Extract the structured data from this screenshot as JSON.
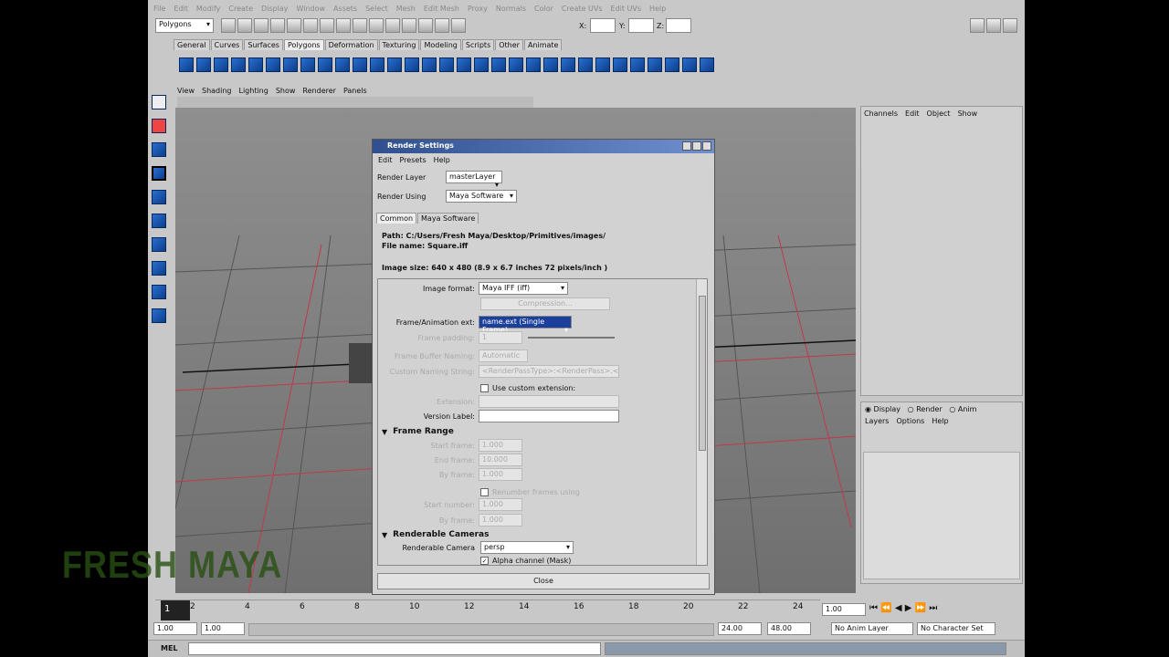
{
  "menubar": [
    "File",
    "Edit",
    "Modify",
    "Create",
    "Display",
    "Window",
    "Assets",
    "Select",
    "Mesh",
    "Edit Mesh",
    "Proxy",
    "Normals",
    "Color",
    "Create UVs",
    "Edit UVs",
    "Help"
  ],
  "mode_select": "Polygons",
  "coord_labels": {
    "x": "X:",
    "y": "Y:",
    "z": "Z:"
  },
  "shelf_tabs": [
    "General",
    "Curves",
    "Surfaces",
    "Polygons",
    "Deformation",
    "Texturing",
    "Modeling",
    "Scripts",
    "Other",
    "Animate"
  ],
  "shelf_selected": "Polygons",
  "viewport_menu": [
    "View",
    "Shading",
    "Lighting",
    "Show",
    "Renderer",
    "Panels"
  ],
  "render_settings": {
    "title": "Render Settings",
    "menu": [
      "Edit",
      "Presets",
      "Help"
    ],
    "render_layer_label": "Render Layer",
    "render_layer_value": "masterLayer",
    "render_using_label": "Render Using",
    "render_using_value": "Maya Software",
    "tabs": [
      "Common",
      "Maya Software"
    ],
    "path": "Path: C:/Users/Fresh Maya/Desktop/Primitives/images/",
    "filename": "File name:  Square.iff",
    "image_size": "Image size: 640 x 480 (8.9 x 6.7 inches 72 pixels/inch )",
    "image_format_label": "Image format:",
    "image_format_value": "Maya IFF (iff)",
    "compression_label": "Compression...",
    "frame_anim_label": "Frame/Animation ext:",
    "frame_anim_value": "name.ext (Single Frame)",
    "frame_padding_label": "Frame padding:",
    "frame_padding_value": "1",
    "fb_naming_label": "Frame Buffer Naming:",
    "fb_naming_value": "Automatic",
    "custom_naming_label": "Custom Naming String:",
    "custom_naming_value": "<RenderPassType>:<RenderPass>.<Came",
    "use_custom_ext": "Use custom extension:",
    "extension_label": "Extension:",
    "version_label": "Version Label:",
    "frame_range_header": "Frame Range",
    "start_frame_label": "Start frame:",
    "start_frame_value": "1.000",
    "end_frame_label": "End frame:",
    "end_frame_value": "10.000",
    "by_frame_label": "By frame:",
    "by_frame_value": "1.000",
    "renumber_label": "Renumber frames using",
    "start_number_label": "Start number:",
    "start_number_value": "1.000",
    "by_frame2_label": "By frame:",
    "by_frame2_value": "1.000",
    "cameras_header": "Renderable Cameras",
    "renderable_camera_label": "Renderable Camera",
    "renderable_camera_value": "persp",
    "alpha_label": "Alpha channel (Mask)",
    "close": "Close"
  },
  "channel_box": {
    "menu": [
      "Channels",
      "Edit",
      "Object",
      "Show"
    ]
  },
  "layers": {
    "radios": [
      "Display",
      "Render",
      "Anim"
    ],
    "menu": [
      "Layers",
      "Options",
      "Help"
    ]
  },
  "timeline": {
    "ticks": [
      "2",
      "4",
      "6",
      "8",
      "10",
      "12",
      "14",
      "16",
      "18",
      "20",
      "22",
      "24"
    ],
    "current": "1",
    "current_field": "1.00"
  },
  "range": {
    "start": "1.00",
    "start2": "1.00",
    "end": "24.00",
    "end2": "48.00",
    "anim_layer": "No Anim Layer",
    "char_set": "No Character Set"
  },
  "mel_label": "MEL",
  "watermark": "FRESH MAYA"
}
